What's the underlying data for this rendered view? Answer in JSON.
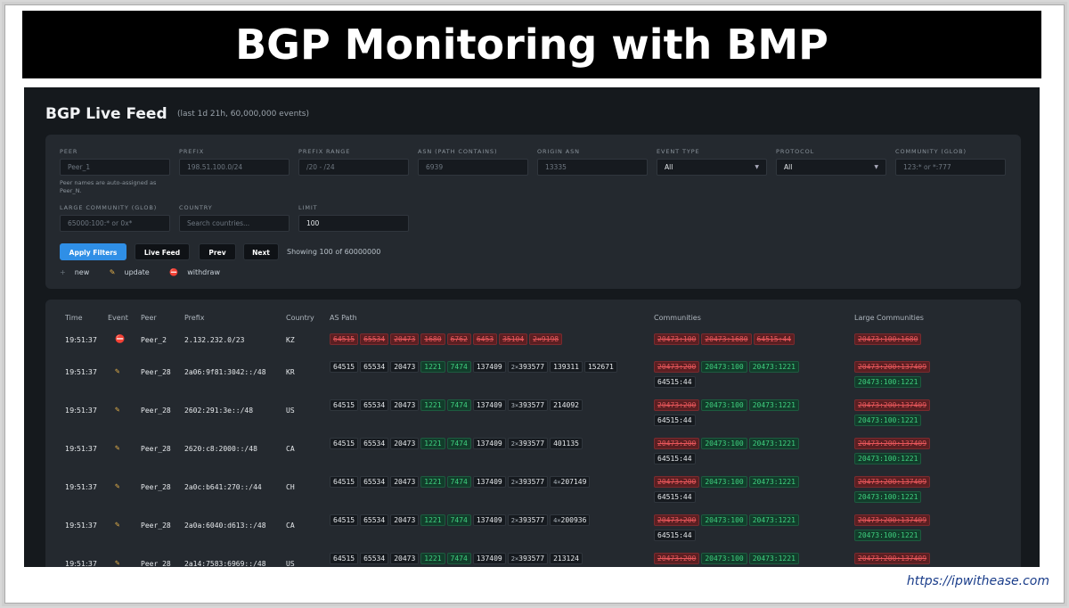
{
  "banner": {
    "title": "BGP Monitoring with BMP"
  },
  "app": {
    "title": "BGP Live Feed",
    "subtitle": "(last 1d 21h, 60,000,000 events)"
  },
  "filters": {
    "peer": {
      "label": "PEER",
      "placeholder": "Peer_1",
      "note": "Peer names are auto-assigned as Peer_N."
    },
    "prefix": {
      "label": "PREFIX",
      "placeholder": "198.51.100.0/24"
    },
    "prefix_range": {
      "label": "PREFIX RANGE",
      "placeholder": "/20 - /24"
    },
    "asn_path": {
      "label": "ASN (PATH CONTAINS)",
      "placeholder": "6939"
    },
    "origin_asn": {
      "label": "ORIGIN ASN",
      "placeholder": "13335"
    },
    "event_type": {
      "label": "EVENT TYPE",
      "value": "All"
    },
    "protocol": {
      "label": "PROTOCOL",
      "value": "All"
    },
    "community": {
      "label": "COMMUNITY (GLOB)",
      "placeholder": "123:* or *:777"
    },
    "large_community": {
      "label": "LARGE COMMUNITY (GLOB)",
      "placeholder": "65000:100:* or 0x*"
    },
    "country": {
      "label": "COUNTRY",
      "placeholder": "Search countries..."
    },
    "limit": {
      "label": "LIMIT",
      "value": "100"
    }
  },
  "buttons": {
    "apply": "Apply Filters",
    "live": "Live Feed",
    "prev": "Prev",
    "next": "Next"
  },
  "showing": "Showing 100 of 60000000",
  "legend": {
    "new": "new",
    "update": "update",
    "withdraw": "withdraw"
  },
  "columns": {
    "time": "Time",
    "event": "Event",
    "peer": "Peer",
    "prefix": "Prefix",
    "country": "Country",
    "as_path": "AS Path",
    "communities": "Communities",
    "large_communities": "Large Communities"
  },
  "rows": [
    {
      "time": "19:51:37",
      "event": "withdraw",
      "peer": "Peer_2",
      "prefix": "2.132.232.0/23",
      "country": "KZ",
      "path": [
        {
          "v": "64515",
          "s": "r"
        },
        {
          "v": "65534",
          "s": "r"
        },
        {
          "v": "20473",
          "s": "r"
        },
        {
          "v": "1680",
          "s": "r"
        },
        {
          "v": "6762",
          "s": "r"
        },
        {
          "v": "6453",
          "s": "r"
        },
        {
          "v": "35104",
          "s": "r"
        },
        {
          "v": "2×9198",
          "s": "r"
        }
      ],
      "comms": [
        {
          "v": "20473:100",
          "s": "r"
        },
        {
          "v": "20473:1680",
          "s": "r"
        },
        {
          "v": "64515:44",
          "s": "r"
        }
      ],
      "large": [
        {
          "v": "20473:100:1680",
          "s": "r"
        }
      ]
    },
    {
      "time": "19:51:37",
      "event": "update",
      "peer": "Peer_28",
      "prefix": "2a06:9f81:3042::/48",
      "country": "KR",
      "path": [
        {
          "v": "64515",
          "s": "n"
        },
        {
          "v": "65534",
          "s": "n"
        },
        {
          "v": "20473",
          "s": "n"
        },
        {
          "v": "1221",
          "s": "g"
        },
        {
          "v": "7474",
          "s": "g"
        },
        {
          "v": "137409",
          "s": "n"
        },
        {
          "v": "393577",
          "s": "n",
          "x": "2×"
        },
        {
          "v": "139311",
          "s": "n"
        },
        {
          "v": "152671",
          "s": "n"
        }
      ],
      "comms": [
        {
          "v": "20473:200",
          "s": "r"
        },
        {
          "v": "20473:100",
          "s": "g"
        },
        {
          "v": "20473:1221",
          "s": "g"
        },
        {
          "v": "64515:44",
          "s": "n"
        }
      ],
      "large": [
        {
          "v": "20473:200:137409",
          "s": "r"
        },
        {
          "v": "20473:100:1221",
          "s": "g"
        }
      ]
    },
    {
      "time": "19:51:37",
      "event": "update",
      "peer": "Peer_28",
      "prefix": "2602:291:3e::/48",
      "country": "US",
      "path": [
        {
          "v": "64515",
          "s": "n"
        },
        {
          "v": "65534",
          "s": "n"
        },
        {
          "v": "20473",
          "s": "n"
        },
        {
          "v": "1221",
          "s": "g"
        },
        {
          "v": "7474",
          "s": "g"
        },
        {
          "v": "137409",
          "s": "n"
        },
        {
          "v": "393577",
          "s": "n",
          "x": "3×"
        },
        {
          "v": "214092",
          "s": "n"
        }
      ],
      "comms": [
        {
          "v": "20473:200",
          "s": "r"
        },
        {
          "v": "20473:100",
          "s": "g"
        },
        {
          "v": "20473:1221",
          "s": "g"
        },
        {
          "v": "64515:44",
          "s": "n"
        }
      ],
      "large": [
        {
          "v": "20473:200:137409",
          "s": "r"
        },
        {
          "v": "20473:100:1221",
          "s": "g"
        }
      ]
    },
    {
      "time": "19:51:37",
      "event": "update",
      "peer": "Peer_28",
      "prefix": "2620:c8:2000::/48",
      "country": "CA",
      "path": [
        {
          "v": "64515",
          "s": "n"
        },
        {
          "v": "65534",
          "s": "n"
        },
        {
          "v": "20473",
          "s": "n"
        },
        {
          "v": "1221",
          "s": "g"
        },
        {
          "v": "7474",
          "s": "g"
        },
        {
          "v": "137409",
          "s": "n"
        },
        {
          "v": "393577",
          "s": "n",
          "x": "2×"
        },
        {
          "v": "401135",
          "s": "n"
        }
      ],
      "comms": [
        {
          "v": "20473:200",
          "s": "r"
        },
        {
          "v": "20473:100",
          "s": "g"
        },
        {
          "v": "20473:1221",
          "s": "g"
        },
        {
          "v": "64515:44",
          "s": "n"
        }
      ],
      "large": [
        {
          "v": "20473:200:137409",
          "s": "r"
        },
        {
          "v": "20473:100:1221",
          "s": "g"
        }
      ]
    },
    {
      "time": "19:51:37",
      "event": "update",
      "peer": "Peer_28",
      "prefix": "2a0c:b641:270::/44",
      "country": "CH",
      "path": [
        {
          "v": "64515",
          "s": "n"
        },
        {
          "v": "65534",
          "s": "n"
        },
        {
          "v": "20473",
          "s": "n"
        },
        {
          "v": "1221",
          "s": "g"
        },
        {
          "v": "7474",
          "s": "g"
        },
        {
          "v": "137409",
          "s": "n"
        },
        {
          "v": "393577",
          "s": "n",
          "x": "2×"
        },
        {
          "v": "207149",
          "s": "n",
          "x": "4×"
        }
      ],
      "comms": [
        {
          "v": "20473:200",
          "s": "r"
        },
        {
          "v": "20473:100",
          "s": "g"
        },
        {
          "v": "20473:1221",
          "s": "g"
        },
        {
          "v": "64515:44",
          "s": "n"
        }
      ],
      "large": [
        {
          "v": "20473:200:137409",
          "s": "r"
        },
        {
          "v": "20473:100:1221",
          "s": "g"
        }
      ]
    },
    {
      "time": "19:51:37",
      "event": "update",
      "peer": "Peer_28",
      "prefix": "2a0a:6040:d613::/48",
      "country": "CA",
      "path": [
        {
          "v": "64515",
          "s": "n"
        },
        {
          "v": "65534",
          "s": "n"
        },
        {
          "v": "20473",
          "s": "n"
        },
        {
          "v": "1221",
          "s": "g"
        },
        {
          "v": "7474",
          "s": "g"
        },
        {
          "v": "137409",
          "s": "n"
        },
        {
          "v": "393577",
          "s": "n",
          "x": "2×"
        },
        {
          "v": "200936",
          "s": "n",
          "x": "4×"
        }
      ],
      "comms": [
        {
          "v": "20473:200",
          "s": "r"
        },
        {
          "v": "20473:100",
          "s": "g"
        },
        {
          "v": "20473:1221",
          "s": "g"
        },
        {
          "v": "64515:44",
          "s": "n"
        }
      ],
      "large": [
        {
          "v": "20473:200:137409",
          "s": "r"
        },
        {
          "v": "20473:100:1221",
          "s": "g"
        }
      ]
    },
    {
      "time": "19:51:37",
      "event": "update",
      "peer": "Peer_28",
      "prefix": "2a14:7583:6969::/48",
      "country": "US",
      "path": [
        {
          "v": "64515",
          "s": "n"
        },
        {
          "v": "65534",
          "s": "n"
        },
        {
          "v": "20473",
          "s": "n"
        },
        {
          "v": "1221",
          "s": "g"
        },
        {
          "v": "7474",
          "s": "g"
        },
        {
          "v": "137409",
          "s": "n"
        },
        {
          "v": "393577",
          "s": "n",
          "x": "2×"
        },
        {
          "v": "213124",
          "s": "n"
        }
      ],
      "comms": [
        {
          "v": "20473:200",
          "s": "r"
        },
        {
          "v": "20473:100",
          "s": "g"
        },
        {
          "v": "20473:1221",
          "s": "g"
        }
      ],
      "large": [
        {
          "v": "20473:200:137409",
          "s": "r"
        }
      ]
    }
  ],
  "watermark": "https://ipwithease.com"
}
